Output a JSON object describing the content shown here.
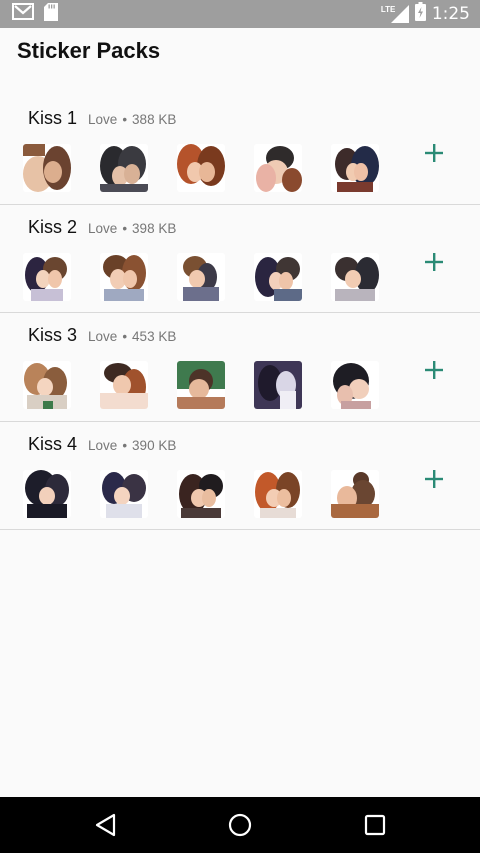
{
  "status_bar": {
    "time": "1:25",
    "network": "LTE",
    "icons": [
      "gmail-icon",
      "sd-card-icon",
      "lte-signal-icon",
      "battery-icon"
    ]
  },
  "app": {
    "title": "Sticker Packs"
  },
  "packs": [
    {
      "name": "Kiss 1",
      "publisher": "Love",
      "separator": "•",
      "size": "388 KB"
    },
    {
      "name": "Kiss 2",
      "publisher": "Love",
      "separator": "•",
      "size": "398 KB"
    },
    {
      "name": "Kiss 3",
      "publisher": "Love",
      "separator": "•",
      "size": "453 KB"
    },
    {
      "name": "Kiss 4",
      "publisher": "Love",
      "separator": "•",
      "size": "390 KB"
    }
  ],
  "add_icon": "plus-icon",
  "nav_bar": {
    "icons": [
      "back-icon",
      "home-icon",
      "recents-icon"
    ]
  },
  "colors": {
    "accent": "#2a8a75",
    "status_bar": "#9e9e9e",
    "background": "#fafafa",
    "divider": "#d9d9d9",
    "meta_text": "#777777"
  }
}
